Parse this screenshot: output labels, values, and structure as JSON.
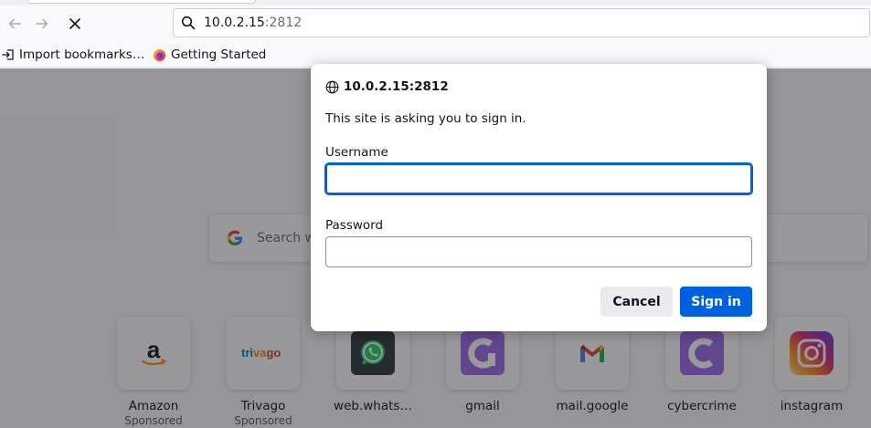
{
  "browser": {
    "url_host": "10.0.2.15",
    "url_port": ":2812"
  },
  "bookmarks": [
    {
      "label": "Import bookmarks…",
      "icon": "import-icon"
    },
    {
      "label": "Getting Started",
      "icon": "firefox-icon"
    }
  ],
  "newtab": {
    "search_placeholder": "Search with Google or enter address",
    "tiles": [
      {
        "name": "Amazon",
        "sub": "Sponsored",
        "icon": "amazon-logo-icon"
      },
      {
        "name": "Trivago",
        "sub": "Sponsored",
        "icon": "trivago-logo-icon"
      },
      {
        "name": "web.whats…",
        "sub": "",
        "icon": "whatsapp-icon"
      },
      {
        "name": "gmail",
        "sub": "",
        "icon": "purple-c-icon"
      },
      {
        "name": "mail.google",
        "sub": "",
        "icon": "gmail-icon"
      },
      {
        "name": "cybercrime",
        "sub": "",
        "icon": "purple-c-icon"
      },
      {
        "name": "instagram",
        "sub": "",
        "icon": "instagram-icon"
      }
    ]
  },
  "dialog": {
    "host": "10.0.2.15:2812",
    "message": "This site is asking you to sign in.",
    "username_label": "Username",
    "username_value": "",
    "password_label": "Password",
    "password_value": "",
    "cancel_label": "Cancel",
    "signin_label": "Sign in"
  },
  "colors": {
    "accent": "#0061e0",
    "overlay": "#1c1b22"
  }
}
